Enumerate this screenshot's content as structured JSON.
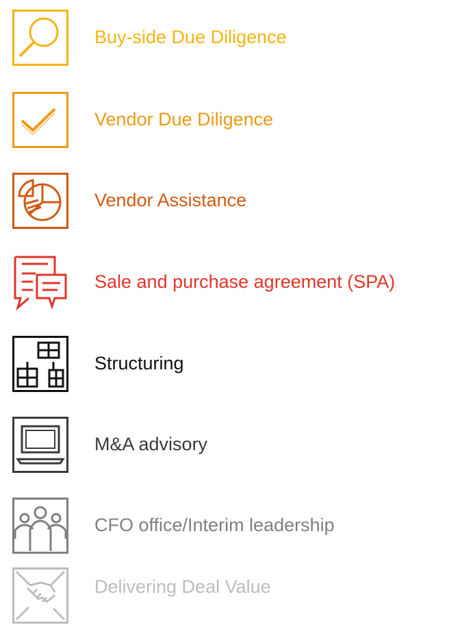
{
  "services": [
    {
      "label": "Buy-side Due Diligence",
      "icon": "magnifier-icon",
      "color": "#f5b50f"
    },
    {
      "label": "Vendor Due Diligence",
      "icon": "checkmark-icon",
      "color": "#ed9a14"
    },
    {
      "label": "Vendor Assistance",
      "icon": "pie-chart-icon",
      "color": "#d15a14"
    },
    {
      "label": "Sale and purchase agreement (SPA)",
      "icon": "chat-document-icon",
      "color": "#e1352a"
    },
    {
      "label": "Structuring",
      "icon": "building-blocks-icon",
      "color": "#111111"
    },
    {
      "label": "M&A advisory",
      "icon": "laptop-icon",
      "color": "#3a3a3a"
    },
    {
      "label": "CFO office/Interim leadership",
      "icon": "people-group-icon",
      "color": "#808080"
    },
    {
      "label": "Delivering Deal Value",
      "icon": "handshake-icon",
      "color": "#bdbdbd"
    }
  ]
}
